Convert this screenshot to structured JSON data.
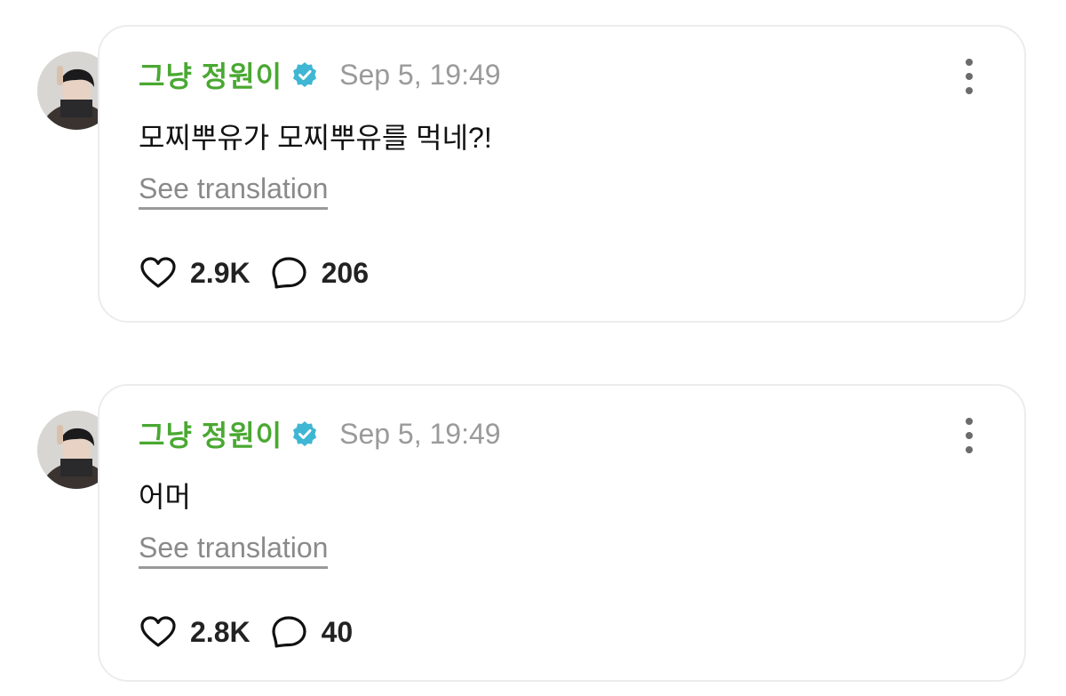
{
  "posts": [
    {
      "author": "그냥 정원이",
      "timestamp": "Sep 5, 19:49",
      "text": "모찌뿌유가 모찌뿌유를 먹네?!",
      "translate_label": "See translation",
      "likes": "2.9K",
      "comments": "206"
    },
    {
      "author": "그냥 정원이",
      "timestamp": "Sep 5, 19:49",
      "text": "어머",
      "translate_label": "See translation",
      "likes": "2.8K",
      "comments": "40"
    }
  ],
  "icons": {
    "verified": "verified-badge-icon",
    "more": "more-vertical-icon",
    "like": "heart-icon",
    "comment": "comment-bubble-icon"
  },
  "colors": {
    "author_name": "#4aa832",
    "verified_badge": "#3fb6d3",
    "timestamp": "#9a9a9a",
    "card_border": "#ececef"
  }
}
